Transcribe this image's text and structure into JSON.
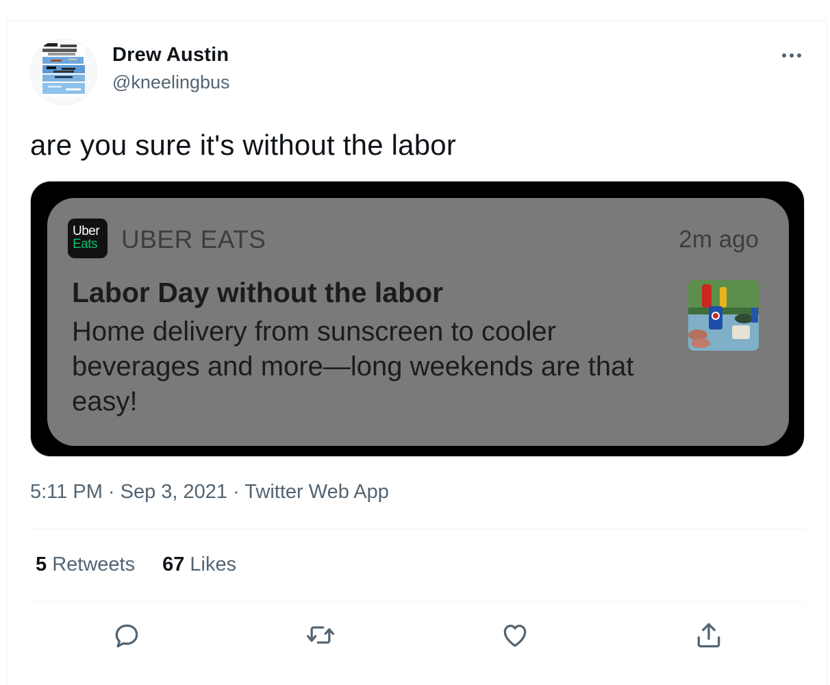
{
  "tweet": {
    "author_name": "Drew Austin",
    "handle": "@kneelingbus",
    "text": "are you sure it's without the labor",
    "timestamp": "5:11 PM · Sep 3, 2021 · Twitter Web App",
    "retweets_count": "5",
    "retweets_label": "Retweets",
    "likes_count": "67",
    "likes_label": "Likes"
  },
  "notification": {
    "icon_line1": "Uber",
    "icon_line2": "Eats",
    "app_name": "UBER EATS",
    "time": "2m ago",
    "title": "Labor Day without the labor",
    "body": "Home delivery from sunscreen to cooler beverages and more—long weekends are that easy!"
  },
  "colors": {
    "secondary_text": "#536471",
    "uber_green": "#06c167",
    "notification_bg": "#7a7a7a"
  },
  "icons": [
    "more-icon",
    "reply-icon",
    "retweet-icon",
    "like-icon",
    "share-icon"
  ]
}
